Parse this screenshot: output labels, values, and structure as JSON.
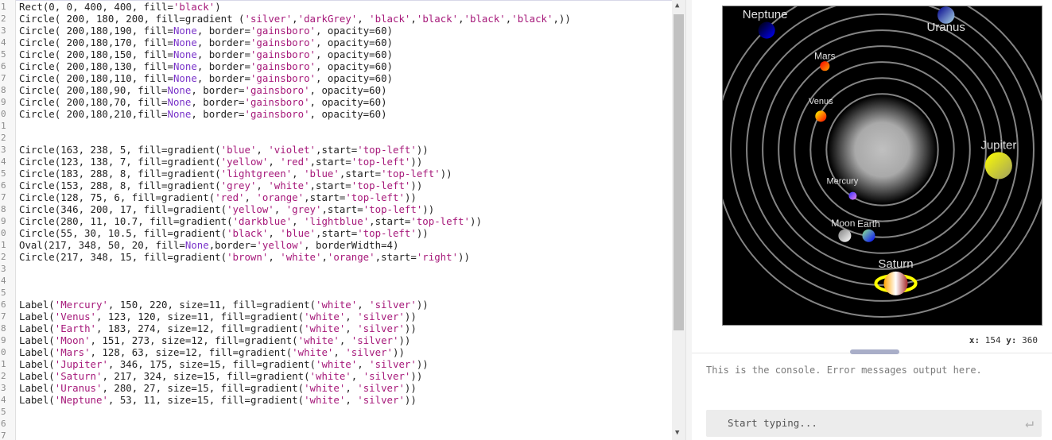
{
  "editor": {
    "lines": [
      "Rect(0, 0, 400, 400, fill='black')",
      "Circle( 200, 180, 200, fill=gradient ('silver','darkGrey', 'black','black','black','black',))",
      "Circle( 200,180,190, fill=None, border='gainsboro', opacity=60)",
      "Circle( 200,180,170, fill=None, border='gainsboro', opacity=60)",
      "Circle( 200,180,150, fill=None, border='gainsboro', opacity=60)",
      "Circle( 200,180,130, fill=None, border='gainsboro', opacity=60)",
      "Circle( 200,180,110, fill=None, border='gainsboro', opacity=60)",
      "Circle( 200,180,90, fill=None, border='gainsboro', opacity=60)",
      "Circle( 200,180,70, fill=None, border='gainsboro', opacity=60)",
      "Circle( 200,180,210,fill=None, border='gainsboro', opacity=60)",
      "",
      "",
      "Circle(163, 238, 5, fill=gradient('blue', 'violet',start='top-left'))",
      "Circle(123, 138, 7, fill=gradient('yellow', 'red',start='top-left'))",
      "Circle(183, 288, 8, fill=gradient('lightgreen', 'blue',start='top-left'))",
      "Circle(153, 288, 8, fill=gradient('grey', 'white',start='top-left'))",
      "Circle(128, 75, 6, fill=gradient('red', 'orange',start='top-left'))",
      "Circle(346, 200, 17, fill=gradient('yellow', 'grey',start='top-left'))",
      "Circle(280, 11, 10.7, fill=gradient('darkblue', 'lightblue',start='top-left'))",
      "Circle(55, 30, 10.5, fill=gradient('black', 'blue',start='top-left'))",
      "Oval(217, 348, 50, 20, fill=None,border='yellow', borderWidth=4)",
      "Circle(217, 348, 15, fill=gradient('brown', 'white','orange',start='right'))",
      "",
      "",
      "",
      "Label('Mercury', 150, 220, size=11, fill=gradient('white', 'silver'))",
      "Label('Venus', 123, 120, size=11, fill=gradient('white', 'silver'))",
      "Label('Earth', 183, 274, size=12, fill=gradient('white', 'silver'))",
      "Label('Moon', 151, 273, size=12, fill=gradient('white', 'silver'))",
      "Label('Mars', 128, 63, size=12, fill=gradient('white', 'silver'))",
      "Label('Jupiter', 346, 175, size=15, fill=gradient('white', 'silver'))",
      "Label('Saturn', 217, 324, size=15, fill=gradient('white', 'silver'))",
      "Label('Uranus', 280, 27, size=15, fill=gradient('white', 'silver'))",
      "Label('Neptune', 53, 11, size=15, fill=gradient('white', 'silver'))",
      "",
      "",
      ""
    ],
    "gutter_numbers": [
      "1",
      "2",
      "3",
      "4",
      "5",
      "6",
      "7",
      "8",
      "9",
      "0",
      "1",
      "2",
      "3",
      "4",
      "5",
      "6",
      "7",
      "8",
      "9",
      "0",
      "1",
      "2",
      "3",
      "4",
      "5",
      "6",
      "7",
      "8",
      "9",
      "0",
      "1",
      "2",
      "3",
      "4",
      "5",
      "6",
      "7"
    ]
  },
  "canvas": {
    "labels": {
      "neptune": "Neptune",
      "uranus": "Uranus",
      "mars": "Mars",
      "venus": "Venus",
      "jupiter": "Jupiter",
      "mercury": "Mercury",
      "moon": "Moon",
      "earth": "Earth",
      "saturn": "Saturn"
    }
  },
  "coords": {
    "x_label": "x",
    "x_value": "154",
    "y_label": "y",
    "y_value": "360"
  },
  "console": {
    "message": "This is the console. Error messages output here.",
    "placeholder": "Start typing..."
  }
}
